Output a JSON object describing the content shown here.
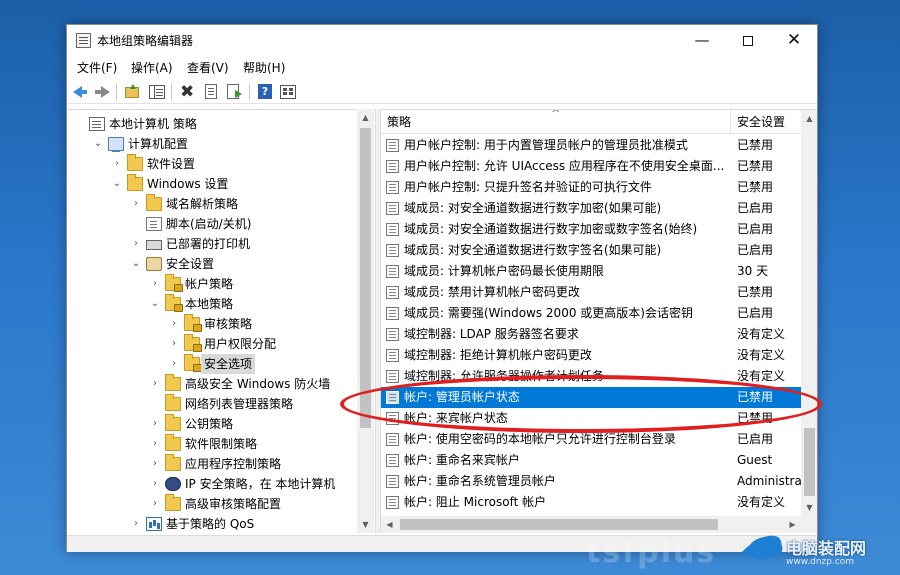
{
  "window": {
    "title": "本地组策略编辑器",
    "controls": {
      "minimize": "—",
      "close": "✕"
    }
  },
  "menu": [
    "文件(F)",
    "操作(A)",
    "查看(V)",
    "帮助(H)"
  ],
  "toolbar": [
    "back",
    "forward",
    "up-folder",
    "show-hide-tree",
    "delete",
    "properties",
    "export-list",
    "help",
    "show-hide-action-pane"
  ],
  "tree": [
    {
      "label": "本地计算机 策略",
      "indent": 0,
      "icon": "book-icon",
      "chevron": ""
    },
    {
      "label": "计算机配置",
      "indent": 1,
      "icon": "computer-icon",
      "chevron": "⌄"
    },
    {
      "label": "软件设置",
      "indent": 2,
      "icon": "folder-icon",
      "chevron": "›"
    },
    {
      "label": "Windows 设置",
      "indent": 2,
      "icon": "folder-icon",
      "chevron": "⌄"
    },
    {
      "label": "域名解析策略",
      "indent": 3,
      "icon": "folder-icon",
      "chevron": "›"
    },
    {
      "label": "脚本(启动/关机)",
      "indent": 3,
      "icon": "script-icon",
      "chevron": ""
    },
    {
      "label": "已部署的打印机",
      "indent": 3,
      "icon": "printer-icon",
      "chevron": "›"
    },
    {
      "label": "安全设置",
      "indent": 3,
      "icon": "security-icon",
      "chevron": "⌄"
    },
    {
      "label": "帐户策略",
      "indent": 4,
      "icon": "locked-folder-icon",
      "chevron": "›"
    },
    {
      "label": "本地策略",
      "indent": 4,
      "icon": "locked-folder-icon",
      "chevron": "⌄"
    },
    {
      "label": "审核策略",
      "indent": 5,
      "icon": "locked-folder-icon",
      "chevron": "›"
    },
    {
      "label": "用户权限分配",
      "indent": 5,
      "icon": "locked-folder-icon",
      "chevron": "›"
    },
    {
      "label": "安全选项",
      "indent": 5,
      "icon": "locked-folder-icon",
      "chevron": "›",
      "selected": true
    },
    {
      "label": "高级安全 Windows 防火墙",
      "indent": 4,
      "icon": "folder-icon",
      "chevron": "›"
    },
    {
      "label": "网络列表管理器策略",
      "indent": 4,
      "icon": "folder-icon",
      "chevron": ""
    },
    {
      "label": "公钥策略",
      "indent": 4,
      "icon": "folder-icon",
      "chevron": "›"
    },
    {
      "label": "软件限制策略",
      "indent": 4,
      "icon": "folder-icon",
      "chevron": "›"
    },
    {
      "label": "应用程序控制策略",
      "indent": 4,
      "icon": "folder-icon",
      "chevron": "›"
    },
    {
      "label": "IP 安全策略，在 本地计算机",
      "indent": 4,
      "icon": "ipsec-icon",
      "chevron": "›"
    },
    {
      "label": "高级审核策略配置",
      "indent": 4,
      "icon": "folder-icon",
      "chevron": "›"
    },
    {
      "label": "基于策略的 QoS",
      "indent": 3,
      "icon": "qos-chart-icon",
      "chevron": "›"
    }
  ],
  "list": {
    "columns": {
      "policy": "策略",
      "setting": "安全设置"
    },
    "rows": [
      {
        "policy": "用户帐户控制: 用于内置管理员帐户的管理员批准模式",
        "setting": "已禁用"
      },
      {
        "policy": "用户帐户控制: 允许 UIAccess 应用程序在不使用安全桌面...",
        "setting": "已禁用"
      },
      {
        "policy": "用户帐户控制: 只提升签名并验证的可执行文件",
        "setting": "已禁用"
      },
      {
        "policy": "域成员: 对安全通道数据进行数字加密(如果可能)",
        "setting": "已启用"
      },
      {
        "policy": "域成员: 对安全通道数据进行数字加密或数字签名(始终)",
        "setting": "已启用"
      },
      {
        "policy": "域成员: 对安全通道数据进行数字签名(如果可能)",
        "setting": "已启用"
      },
      {
        "policy": "域成员: 计算机帐户密码最长使用期限",
        "setting": "30 天"
      },
      {
        "policy": "域成员: 禁用计算机帐户密码更改",
        "setting": "已禁用"
      },
      {
        "policy": "域成员: 需要强(Windows 2000 或更高版本)会话密钥",
        "setting": "已启用"
      },
      {
        "policy": "域控制器: LDAP 服务器签名要求",
        "setting": "没有定义"
      },
      {
        "policy": "域控制器: 拒绝计算机帐户密码更改",
        "setting": "没有定义"
      },
      {
        "policy": "域控制器: 允许服务器操作者计划任务",
        "setting": "没有定义"
      },
      {
        "policy": "帐户: 管理员帐户状态",
        "setting": "已禁用",
        "selected": true
      },
      {
        "policy": "帐户: 来宾帐户状态",
        "setting": "已禁用"
      },
      {
        "policy": "帐户: 使用空密码的本地帐户只允许进行控制台登录",
        "setting": "已启用"
      },
      {
        "policy": "帐户: 重命名来宾帐户",
        "setting": "Guest"
      },
      {
        "policy": "帐户: 重命名系统管理员帐户",
        "setting": "Administrator"
      },
      {
        "policy": "帐户: 阻止 Microsoft 帐户",
        "setting": "没有定义"
      }
    ]
  },
  "watermark": {
    "brand": "电脑装配网",
    "url": "www.dnzp.com",
    "overlay": "tsfplus"
  },
  "colors": {
    "selection": "#0078d7",
    "annotation": "#e02020"
  }
}
